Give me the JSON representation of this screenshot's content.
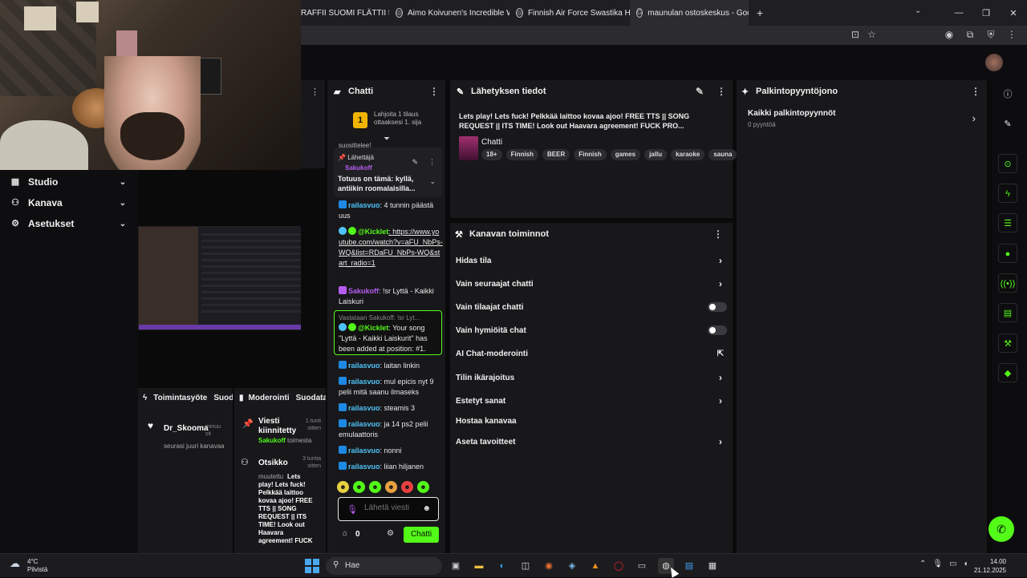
{
  "browser": {
    "tabs": [
      {
        "label": "RAFFII SUOMI FLÄTTII fe"
      },
      {
        "label": "Aimo Koivunen's Incredible WW"
      },
      {
        "label": "Finnish Air Force Swastika Histo"
      },
      {
        "label": "maunulan ostoskeskus - Google"
      }
    ]
  },
  "left_nav": {
    "items": [
      {
        "label": "Studio",
        "icon": "grid-icon"
      },
      {
        "label": "Kanava",
        "icon": "users-icon"
      },
      {
        "label": "Asetukset",
        "icon": "gear-icon"
      }
    ]
  },
  "chat": {
    "title": "Chatti",
    "gift": {
      "badge": "1",
      "text": "Lahjoita 1 tilaus ottaaksesi 1. sija"
    },
    "partial_line": "suosittelee!",
    "pinned": {
      "label": "Lähettäjä",
      "user": "Sakukoff",
      "text": "Totuus on tämä: kyllä, antiikin roomalaisilla..."
    },
    "messages": [
      {
        "user": "railasvuo",
        "text": ": 4 tunnin päästä uus",
        "color": "#4fc3f7"
      },
      {
        "user": "@Kicklet",
        "text": ": https://www.youtube.com/watch?v=aFU_NbPs-WQ&list=RDaFU_NbPs-WQ&start_radio=1",
        "color": "#53fc18"
      },
      {
        "user": "Sakukoff",
        "text": ": !sr Lyttä - Kaikki Laiskuri",
        "color": "#b65cf0"
      }
    ],
    "reply": {
      "context": "Vastataan Sakukoff: !sr Lyt...",
      "user": "@Kicklet",
      "text": ": Your song \"Lyttä - Kaikki Laiskurit\" has been added at position: #1."
    },
    "messages2": [
      {
        "user": "railasvuo",
        "text": ": laitan linkin"
      },
      {
        "user": "railasvuo",
        "text": ": mul epicis nyt 9 pelii mitä saanu ilmaseks"
      },
      {
        "user": "railasvuo",
        "text": ": steamis 3"
      },
      {
        "user": "railasvuo",
        "text": ": ja 14 ps2 pelii emulaattoris"
      },
      {
        "user": "railasvuo",
        "text": ": nonni"
      },
      {
        "user": "railasvuo",
        "text": ": liian hiljanen"
      }
    ],
    "input_placeholder": "Lähetä viesti",
    "store_count": "0",
    "send_label": "Chatti"
  },
  "stream_info": {
    "title": "Lähetyksen tiedot",
    "stream_title": "Lets play! Lets fuck! Pelkkää laittoo kovaa ajoo! FREE TTS || SONG REQUEST || ITS TIME! Look out Haavara agreement! FUCK PRO...",
    "category": "Chatti",
    "tags": [
      "18+",
      "Finnish",
      "BEER",
      "Finnish",
      "games",
      "jallu",
      "karaoke",
      "sauna"
    ]
  },
  "channel_actions": {
    "title": "Kanavan toiminnot",
    "rows": [
      {
        "label": "Hidas tila",
        "control": "chevron"
      },
      {
        "label": "Vain seuraajat chatti",
        "control": "chevron"
      },
      {
        "label": "Vain tilaajat chatti",
        "control": "toggle"
      },
      {
        "label": "Vain hymiöitä chat",
        "control": "toggle"
      },
      {
        "label": "AI Chat-moderointi",
        "control": "external"
      },
      {
        "label": "Tilin ikärajoitus",
        "control": "chevron"
      },
      {
        "label": "Estetyt sanat",
        "control": "chevron"
      },
      {
        "label": "Hostaa kanavaa",
        "control": "none"
      },
      {
        "label": "Aseta tavoitteet",
        "control": "chevron"
      }
    ]
  },
  "rewards": {
    "title": "Palkintopyyntöjono",
    "item_title": "Kaikki palkintopyynnöt",
    "item_sub": "0 pyyntöä"
  },
  "activity": {
    "title": "Toimintasyöte",
    "filter": "Suod",
    "item_user": "Dr_Skooma",
    "item_time": "minuu sit",
    "item_text": "seurasi juuri kanavaa"
  },
  "moderation": {
    "title": "Moderointi",
    "filter": "Suodata",
    "items": [
      {
        "title": "Viesti kiinnitetty",
        "time": "1 tunti sitten",
        "user": "Sakukoff",
        "action": "toimesta"
      },
      {
        "title": "Otsikko",
        "time": "3 tuntia sitten",
        "pre": "muutettu",
        "text": "Lets play! Lets fuck! Pelkkää laittoo kovaa ajoo! FREE TTS || SONG REQUEST || ITS TIME! Look out Haavara agreement! FUCK"
      }
    ]
  },
  "taskbar": {
    "weather_temp": "4°C",
    "weather_desc": "Pilvistä",
    "search": "Hae",
    "time": "14.00",
    "date": "21.12.2025"
  }
}
